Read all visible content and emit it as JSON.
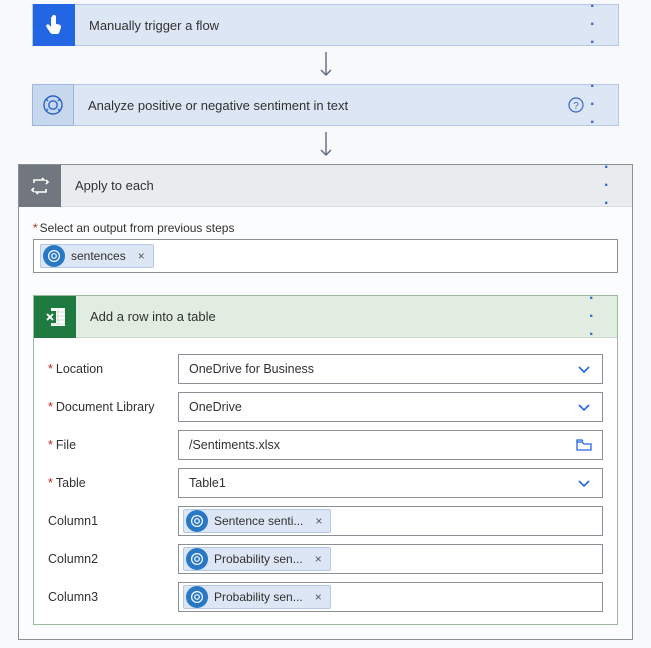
{
  "step1": {
    "title": "Manually trigger a flow"
  },
  "step2": {
    "title": "Analyze positive or negative sentiment in text"
  },
  "applyEach": {
    "title": "Apply to each",
    "selectLabel": "Select an output from previous steps",
    "token": "sentences",
    "x": "×"
  },
  "addRow": {
    "title": "Add a row into a table",
    "fields": {
      "location": {
        "label": "Location",
        "value": "OneDrive for Business",
        "type": "select"
      },
      "doclib": {
        "label": "Document Library",
        "value": "OneDrive",
        "type": "select"
      },
      "file": {
        "label": "File",
        "value": "/Sentiments.xlsx",
        "type": "file"
      },
      "table": {
        "label": "Table",
        "value": "Table1",
        "type": "select"
      },
      "col1": {
        "label": "Column1",
        "token": "Sentence senti...",
        "type": "token"
      },
      "col2": {
        "label": "Column2",
        "token": "Probability sen...",
        "type": "token"
      },
      "col3": {
        "label": "Column3",
        "token": "Probability sen...",
        "type": "token"
      }
    }
  },
  "glyphs": {
    "more": "· · ·",
    "x": "×"
  }
}
